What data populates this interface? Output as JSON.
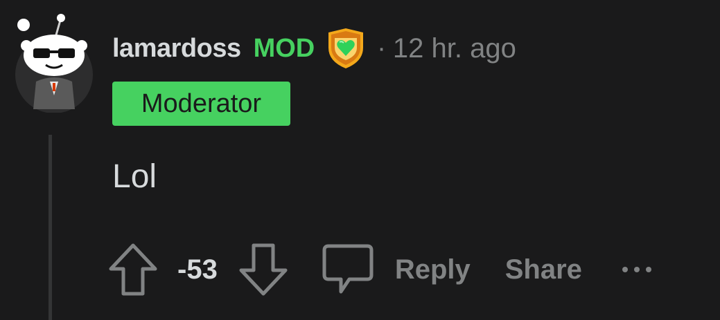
{
  "comment": {
    "username": "lamardoss",
    "mod_label": "MOD",
    "separator": "·",
    "timestamp": "12 hr. ago",
    "flair": "Moderator",
    "body": "Lol",
    "vote_count": "-53",
    "reply_label": "Reply",
    "share_label": "Share"
  },
  "icons": {
    "avatar": "snoo-avatar",
    "badge": "moderator-shield-icon",
    "upvote": "arrow-up-icon",
    "downvote": "arrow-down-icon",
    "comment": "speech-bubble-icon",
    "more": "ellipsis-icon"
  },
  "colors": {
    "background": "#1a1a1b",
    "text": "#d7dadc",
    "muted": "#818384",
    "mod_green": "#46d160",
    "thread_line": "#343536"
  }
}
